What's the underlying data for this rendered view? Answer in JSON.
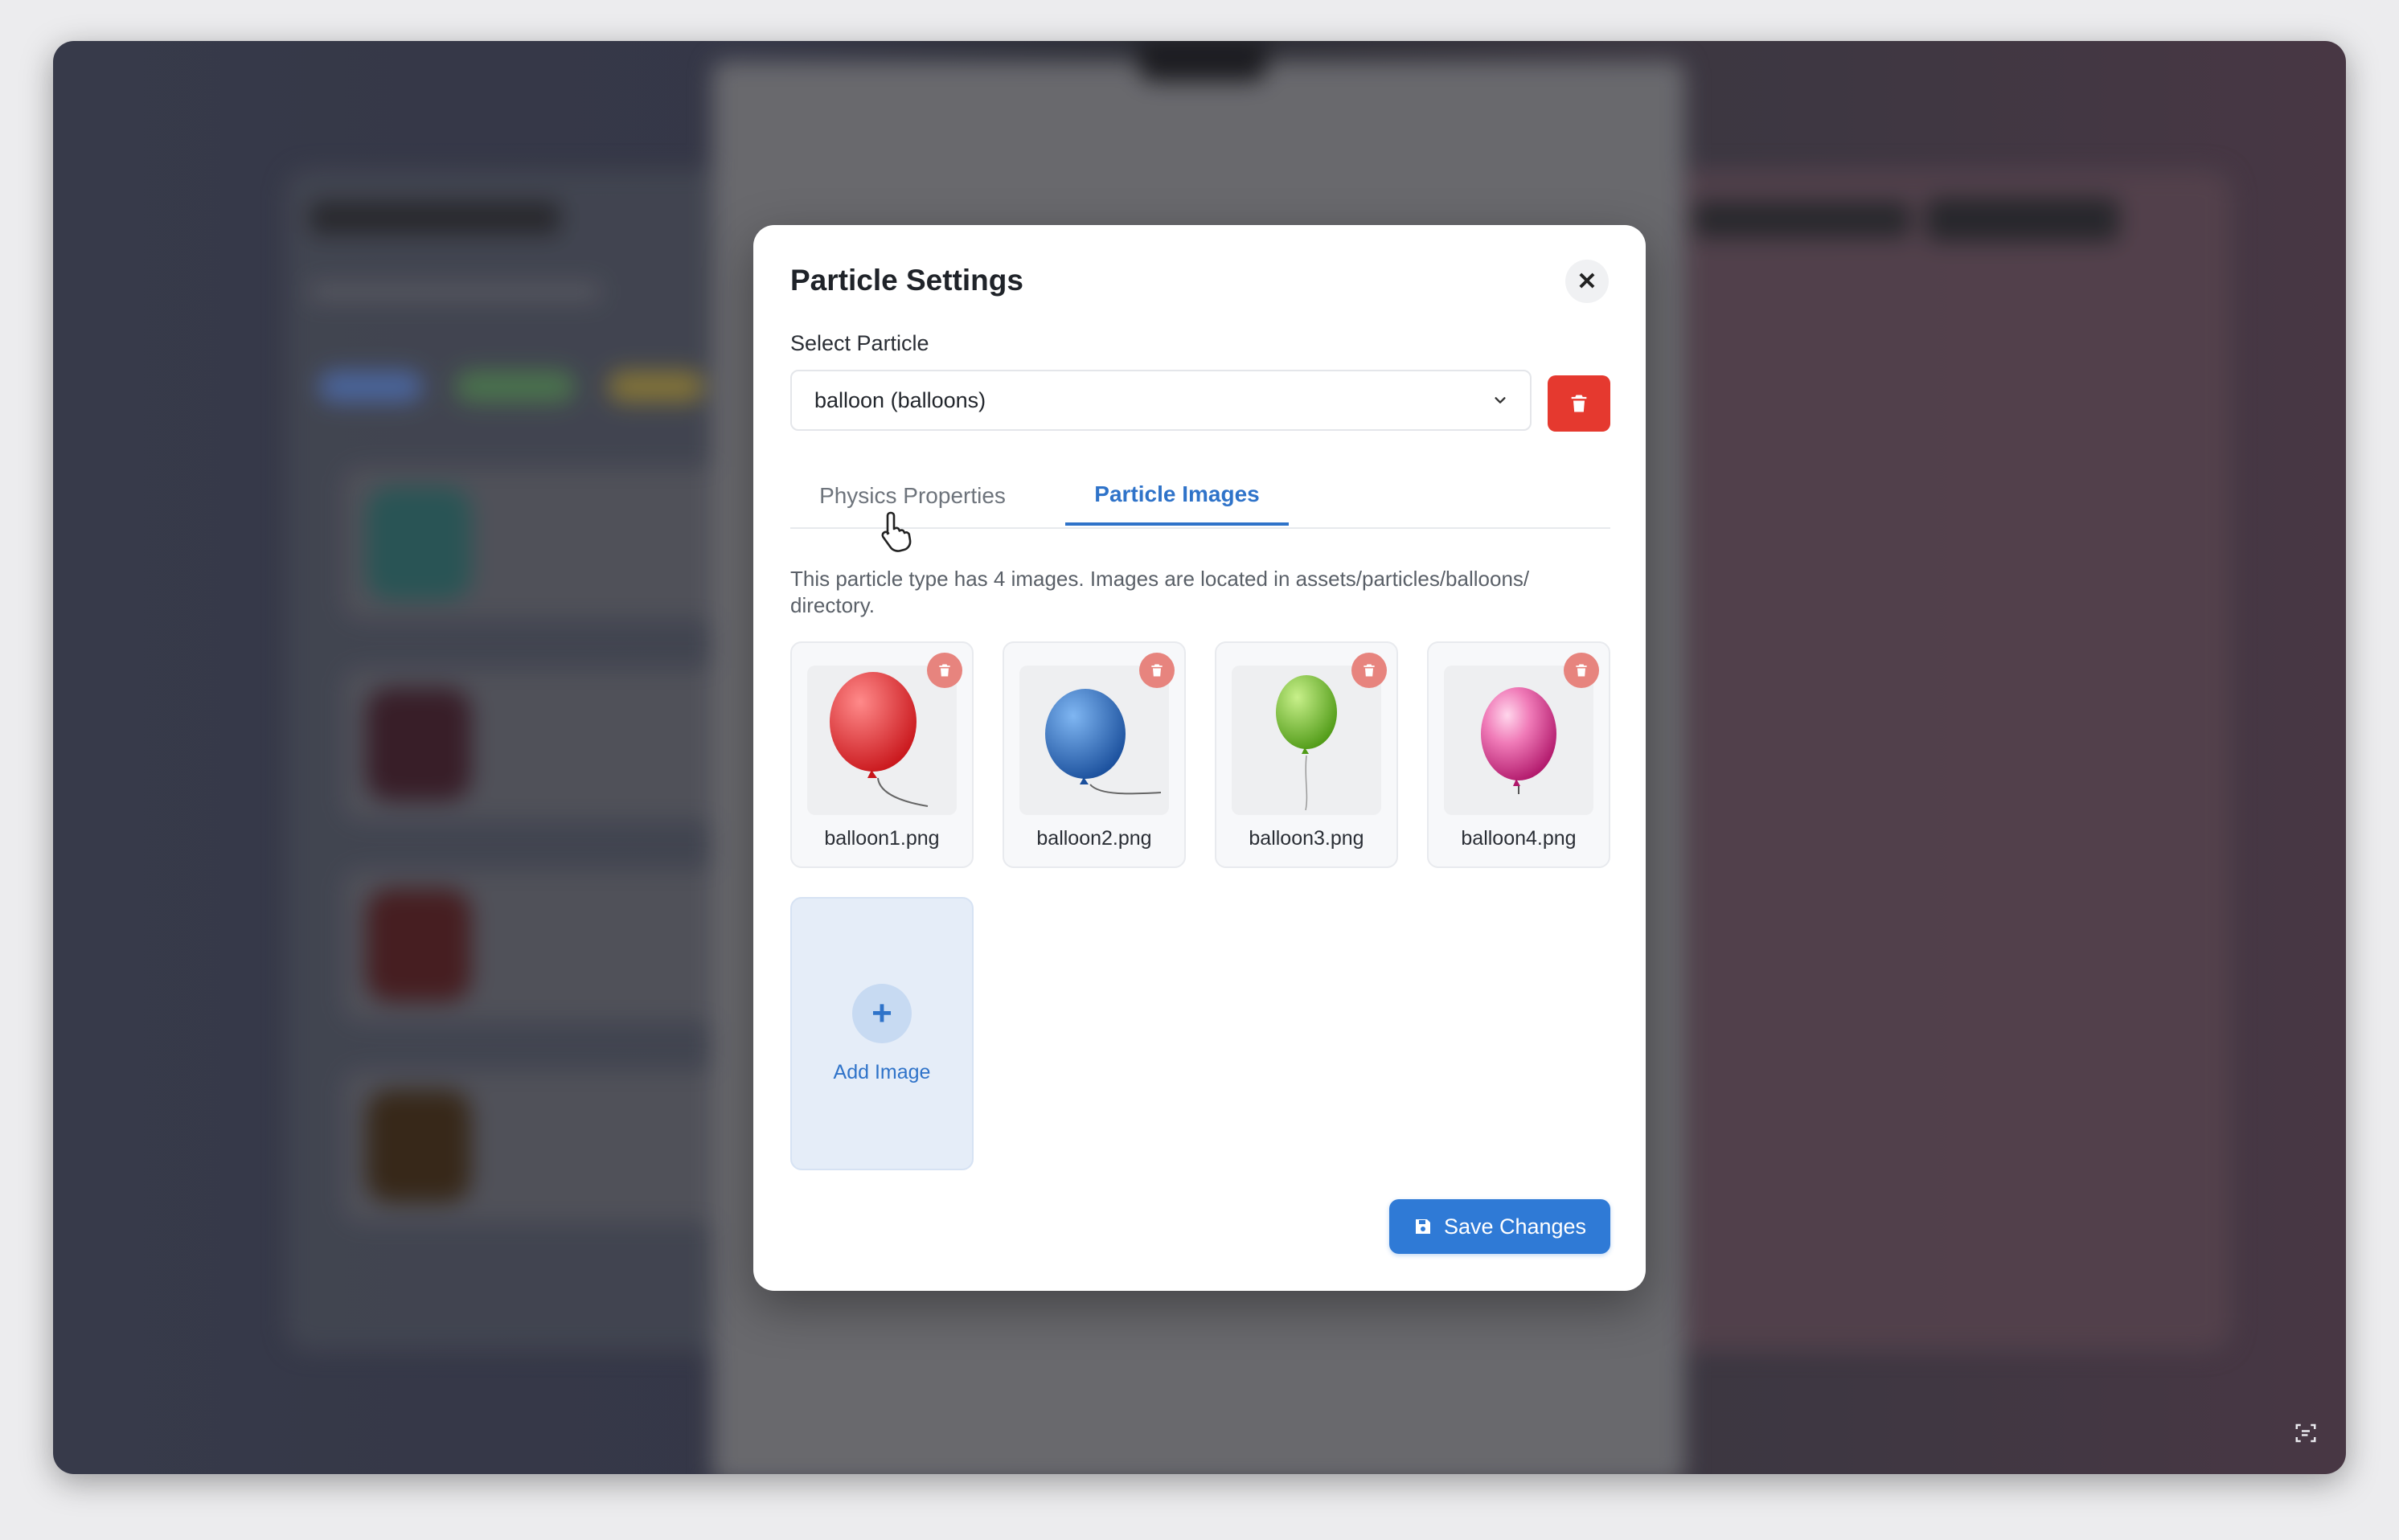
{
  "modal": {
    "title": "Particle Settings",
    "close_icon": "close-icon",
    "select_label": "Select Particle",
    "select_value": "balloon (balloons)",
    "tabs": [
      {
        "label": "Physics Properties",
        "active": false
      },
      {
        "label": "Particle Images",
        "active": true
      }
    ],
    "info": "This particle type has 4 images. Images are located in assets/particles/balloons/ directory.",
    "images": [
      {
        "name": "balloon1.png",
        "color": "#e53b3b"
      },
      {
        "name": "balloon2.png",
        "color": "#2f7ad6"
      },
      {
        "name": "balloon3.png",
        "color": "#7ac42e"
      },
      {
        "name": "balloon4.png",
        "color": "#e85aa6"
      }
    ],
    "add_image_label": "Add Image",
    "save_label": "Save Changes"
  },
  "colors": {
    "accent": "#2f73c9",
    "danger": "#e5392f"
  }
}
